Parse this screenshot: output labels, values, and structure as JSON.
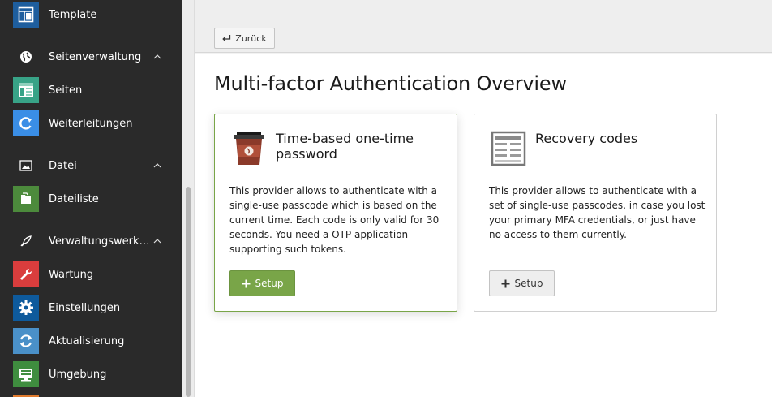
{
  "sidebar": {
    "items": [
      {
        "label": "Template",
        "icon": "template-icon",
        "color": "#1e5e9e"
      },
      {
        "label": "Seitenverwaltung",
        "icon": "globe-icon",
        "group": true
      },
      {
        "label": "Seiten",
        "icon": "pages-icon",
        "color": "#38a387"
      },
      {
        "label": "Weiterleitungen",
        "icon": "redirect-icon",
        "color": "#3a8ee6"
      },
      {
        "label": "Datei",
        "icon": "image-icon",
        "group": true
      },
      {
        "label": "Dateiliste",
        "icon": "filelist-icon",
        "color": "#4c8a3c"
      },
      {
        "label": "Verwaltungswerk…",
        "icon": "rocket-icon",
        "group": true
      },
      {
        "label": "Wartung",
        "icon": "wrench-icon",
        "color": "#d93d3d"
      },
      {
        "label": "Einstellungen",
        "icon": "gear-icon",
        "color": "#0e5a9c"
      },
      {
        "label": "Aktualisierung",
        "icon": "refresh-icon",
        "color": "#4a90c8"
      },
      {
        "label": "Umgebung",
        "icon": "environment-icon",
        "color": "#3f8d3f"
      }
    ]
  },
  "header": {
    "back_label": "Zurück"
  },
  "main": {
    "title": "Multi-factor Authentication Overview",
    "providers": [
      {
        "title": "Time-based one-time password",
        "description": "This provider allows to authenticate with a single-use passcode which is based on the current time. Each code is only valid for 30 seconds. You need a OTP application supporting such tokens.",
        "button_label": "Setup",
        "icon": "otp-cup-icon",
        "accent": "#79a548"
      },
      {
        "title": "Recovery codes",
        "description": "This provider allows to authenticate with a set of single-use passcodes, in case you lost your primary MFA credentials, or just have no access to them currently.",
        "button_label": "Setup",
        "icon": "recovery-codes-icon"
      }
    ]
  }
}
